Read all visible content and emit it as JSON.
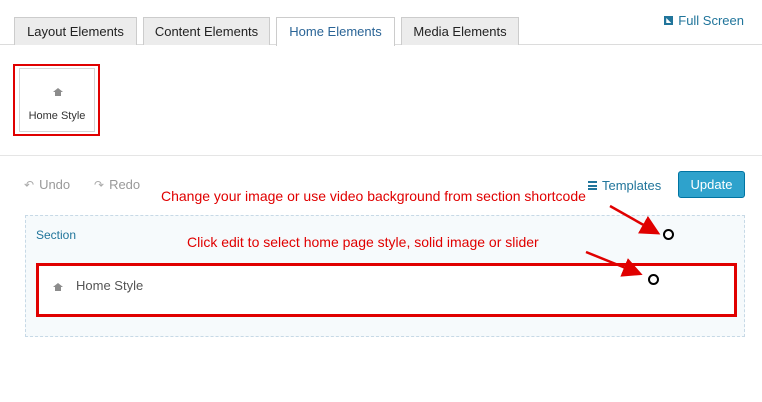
{
  "tabs": [
    {
      "label": "Layout Elements",
      "active": false
    },
    {
      "label": "Content Elements",
      "active": false
    },
    {
      "label": "Home Elements",
      "active": true
    },
    {
      "label": "Media Elements",
      "active": false
    }
  ],
  "fullscreen_label": "Full Screen",
  "elements": [
    {
      "label": "Home Style",
      "icon": "home-icon"
    }
  ],
  "toolbar": {
    "undo_label": "Undo",
    "redo_label": "Redo",
    "templates_label": "Templates",
    "update_label": "Update"
  },
  "builder": {
    "section_label": "Section",
    "row_label": "Home Style"
  },
  "annotations": [
    "Change your image or use video background from section shortcode",
    "Click edit to select home page style, solid image or slider"
  ],
  "colors": {
    "accent": "#21759b",
    "update_button": "#2ea2cc",
    "annotation_red": "#e00000"
  }
}
